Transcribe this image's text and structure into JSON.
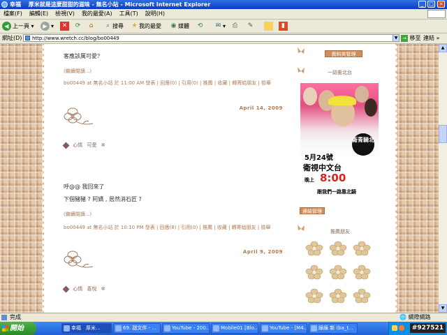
{
  "window": {
    "title": "幸福 　厚米就是這麼甜甜的滋味 - 無名小站 - Microsoft Internet Explorer"
  },
  "menu": [
    "檔案(F)",
    "編輯(E)",
    "檢視(V)",
    "我的最愛(A)",
    "工具(T)",
    "說明(H)"
  ],
  "toolbar": {
    "back": "上一頁",
    "search": "搜尋",
    "favorites": "我的最愛",
    "media": "媒體"
  },
  "address": {
    "label": "網址(D)",
    "url": "http://www.wretch.cc/blog/bo00449",
    "go": "移至",
    "links": "連結"
  },
  "posts": [
    {
      "body_lines": [
        "客應該厲可愛？"
      ],
      "continue": "(繼續閱讀...)",
      "meta": "bo00449 at 無名小站 於 11:00 AM 發表 | 回應(0) | 引用(0) | 推薦 | 收藏 | 轉寄給朋友 | 檢舉",
      "date": "April 14, 2009",
      "mood_label": "心情",
      "mood_value": "可愛"
    },
    {
      "body_lines": [
        "呼@@ 我回來了",
        "下個豬豬 ? 阿嬌 , 居然消石匠 ?"
      ],
      "continue": "(繼續閱讀...)",
      "meta": "bo00449 at 無名小站 於 10:10 PM 發表 | 回應(8) | 引用(0) | 推薦 | 收藏 | 轉寄給朋友 | 檢舉",
      "date": "April 9, 2009",
      "mood_label": "心情",
      "mood_value": "喜悅"
    }
  ],
  "sidebar": {
    "profile_button": "資料夾管理",
    "ad_title": "一路衝北台",
    "ad": {
      "date_line": "5月24號",
      "channel": "衛視中文台",
      "time_prefix": "晚上",
      "time": "8:00",
      "slogan": "跟我們一路靠北騎",
      "badge": "衛青騎北"
    },
    "ad_button": "連結管理",
    "visitors_title": "推薦朋友"
  },
  "status": {
    "left": "完成",
    "zone": "網際網路"
  },
  "taskbar": {
    "start": "開始",
    "items": [
      "幸福　厚米...",
      "69. 甜文伴 - ...",
      "YouTube - 200...",
      "Mobile01 [Blo...",
      "YouTube - [M4...",
      "綠綠 新 (ba_t..."
    ],
    "watermark": "#927521"
  },
  "colors": {
    "accent": "#b07a55",
    "button": "#d08e5c",
    "background": "#e6c9a6"
  }
}
